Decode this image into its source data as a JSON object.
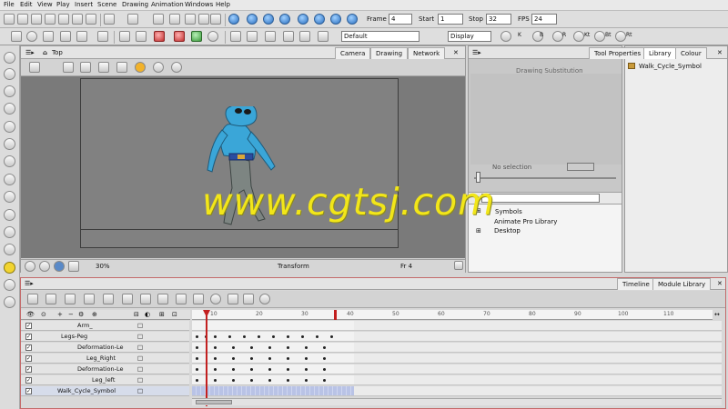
{
  "menu": [
    "File",
    "Edit",
    "View",
    "Play",
    "Insert",
    "Scene",
    "Drawing",
    "Animation",
    "Windows",
    "Help"
  ],
  "playback": {
    "frame_label": "Frame",
    "frame_value": "4",
    "start_label": "Start",
    "start_value": "1",
    "stop_label": "Stop",
    "stop_value": "32",
    "fps_label": "FPS",
    "fps_value": "24"
  },
  "toolbar2": {
    "palette_select": "Default",
    "display_select": "Display",
    "color_keys": [
      "K",
      "B",
      "R",
      "Kt",
      "Bt",
      "Rt"
    ]
  },
  "camera_view": {
    "breadcrumb": "Top",
    "tabs": [
      "Camera",
      "Drawing",
      "Network"
    ],
    "zoom": "30%",
    "tool_status": "Transform",
    "frame_status": "Fr 4",
    "watermark": "www.cgtsj.com"
  },
  "right_panel": {
    "tabs": [
      "Tool Properties",
      "Library",
      "Colour"
    ],
    "drawing_substitution": "Drawing Substitution",
    "no_selection": "No selection",
    "library_tree": [
      "Animate Pro Library",
      "Desktop"
    ],
    "library_tree_partial": "Symbols"
  },
  "library_panel": {
    "symbol_item": "Walk_Cycle_Symbol"
  },
  "timeline": {
    "tabs": [
      "Timeline",
      "Module Library"
    ],
    "layers": [
      "Arm_",
      "Legs-Peg",
      "Deformation-Le",
      "Leg_Right",
      "Deformation-Le",
      "Leg_left",
      "Walk_Cycle_Symbol"
    ],
    "ruler_ticks": [
      "10",
      "20",
      "30",
      "40",
      "50",
      "60",
      "70",
      "80",
      "90",
      "100",
      "110"
    ]
  },
  "colors": {
    "accent_red": "#c21f1f",
    "character_blue": "#3aa6d8",
    "watermark_yellow": "#f2e619"
  }
}
